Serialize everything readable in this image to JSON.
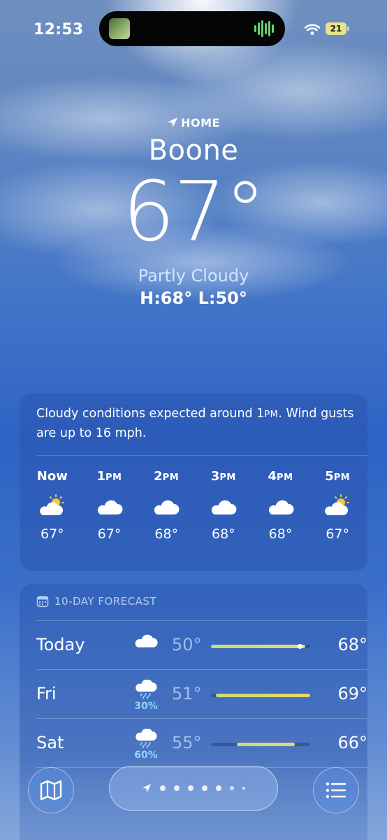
{
  "status_bar": {
    "time": "12:53",
    "battery": "21"
  },
  "location": {
    "tag": "HOME",
    "city": "Boone"
  },
  "current": {
    "temperature": "67°",
    "condition": "Partly Cloudy",
    "high_low": "H:68°  L:50°"
  },
  "hourly": {
    "summary_before": "Cloudy conditions expected around 1",
    "summary_pm": "PM",
    "summary_after": ". Wind gusts are up to 16 mph.",
    "hours": [
      {
        "hour": "Now",
        "suffix": "",
        "icon": "partly-cloudy-icon",
        "temp": "67°"
      },
      {
        "hour": "1",
        "suffix": "PM",
        "icon": "cloud-icon",
        "temp": "67°"
      },
      {
        "hour": "2",
        "suffix": "PM",
        "icon": "cloud-icon",
        "temp": "68°"
      },
      {
        "hour": "3",
        "suffix": "PM",
        "icon": "cloud-icon",
        "temp": "68°"
      },
      {
        "hour": "4",
        "suffix": "PM",
        "icon": "cloud-icon",
        "temp": "68°"
      },
      {
        "hour": "5",
        "suffix": "PM",
        "icon": "partly-cloudy-icon",
        "temp": "67°"
      }
    ]
  },
  "daily": {
    "header": "10-DAY FORECAST",
    "range_min": 50,
    "range_max": 69,
    "current_temp": 67,
    "days": [
      {
        "day": "Today",
        "icon": "cloud-icon",
        "pop": "",
        "low": "50°",
        "high": "68°",
        "low_val": 50,
        "high_val": 68
      },
      {
        "day": "Fri",
        "icon": "rain-icon",
        "pop": "30%",
        "low": "51°",
        "high": "69°",
        "low_val": 51,
        "high_val": 69
      },
      {
        "day": "Sat",
        "icon": "rain-icon",
        "pop": "60%",
        "low": "55°",
        "high": "66°",
        "low_val": 55,
        "high_val": 66
      }
    ]
  },
  "colors": {
    "accent_bar": "#e8d86a",
    "precip": "#8fd6ff"
  }
}
